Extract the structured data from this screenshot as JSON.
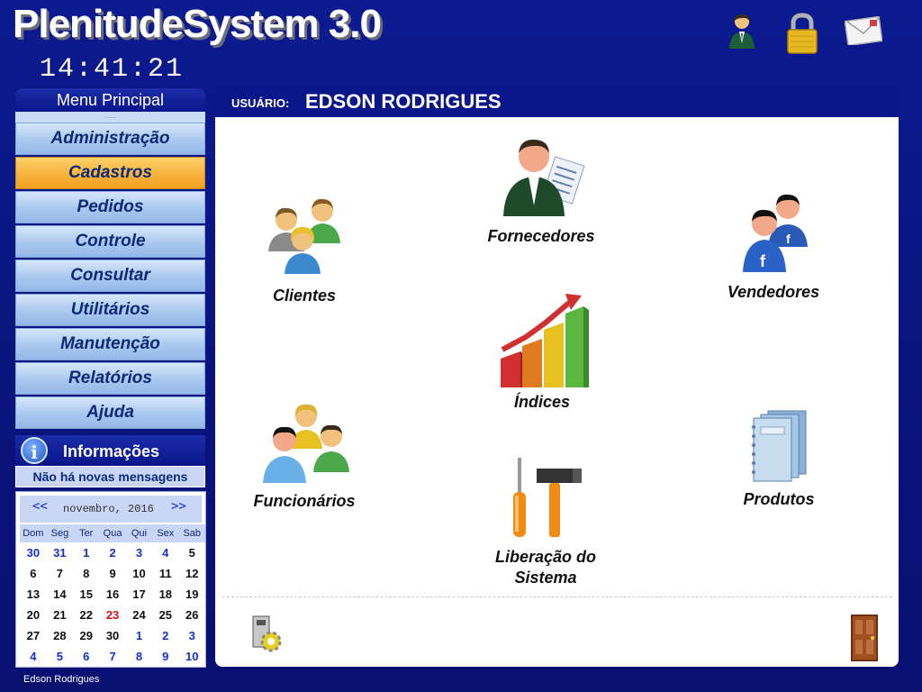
{
  "header": {
    "app_title": "PlenitudeSystem 3.0",
    "clock": "14:41:21"
  },
  "top_icons": [
    "user-icon",
    "lock-icon",
    "mail-icon"
  ],
  "menu": {
    "title": "Menu Principal",
    "grip": ".....",
    "items": [
      {
        "label": "Administração",
        "active": false
      },
      {
        "label": "Cadastros",
        "active": true
      },
      {
        "label": "Pedidos",
        "active": false
      },
      {
        "label": "Controle",
        "active": false
      },
      {
        "label": "Consultar",
        "active": false
      },
      {
        "label": "Utilitários",
        "active": false
      },
      {
        "label": "Manutenção",
        "active": false
      },
      {
        "label": "Relatórios",
        "active": false
      },
      {
        "label": "Ajuda",
        "active": false
      }
    ]
  },
  "info": {
    "title": "Informações",
    "message": "Não há novas mensagens"
  },
  "calendar": {
    "prev": "<<",
    "next": ">>",
    "month_label": "novembro, 2016",
    "weekdays": [
      "Dom",
      "Seg",
      "Ter",
      "Qua",
      "Qui",
      "Sex",
      "Sab"
    ],
    "weeks": [
      [
        "30",
        "31",
        "1",
        "2",
        "3",
        "4",
        "5"
      ],
      [
        "6",
        "7",
        "8",
        "9",
        "10",
        "11",
        "12"
      ],
      [
        "13",
        "14",
        "15",
        "16",
        "17",
        "18",
        "19"
      ],
      [
        "20",
        "21",
        "22",
        "23",
        "24",
        "25",
        "26"
      ],
      [
        "27",
        "28",
        "29",
        "30",
        "1",
        "2",
        "3"
      ],
      [
        "4",
        "5",
        "6",
        "7",
        "8",
        "9",
        "10"
      ]
    ],
    "today": "23"
  },
  "footer": {
    "user": "Edson Rodrigues"
  },
  "panel": {
    "user_label": "USUÁRIO:",
    "user_name": "EDSON RODRIGUES",
    "tiles": {
      "clientes": "Clientes",
      "fornecedores": "Fornecedores",
      "vendedores": "Vendedores",
      "indices": "Índices",
      "funcionarios": "Funcionários",
      "liberacao_line1": "Liberação do",
      "liberacao_line2": "Sistema",
      "produtos": "Produtos"
    }
  },
  "colors": {
    "accent": "#0a168a",
    "menu_active": "#f7b23c",
    "menu_text": "#0b2a78",
    "today": "#e01010"
  }
}
